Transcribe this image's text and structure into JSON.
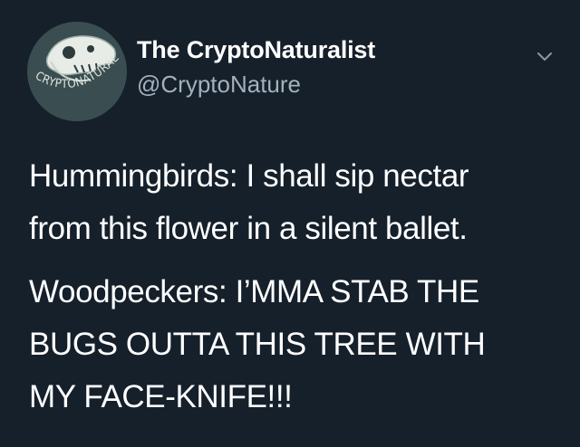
{
  "author": {
    "display_name": "The CryptoNaturalist",
    "handle": "@CryptoNature",
    "avatar_text": "CRYPTONATURALIST"
  },
  "menu": {
    "icon": "chevron-down-icon"
  },
  "tweet": {
    "paragraphs": [
      {
        "lines": [
          "Hummingbirds: I shall sip nectar",
          "from this flower in a silent ballet."
        ]
      },
      {
        "lines": [
          "Woodpeckers: I’MMA STAB THE",
          "BUGS OUTTA THIS TREE WITH",
          "MY FACE-KNIFE!!!"
        ]
      }
    ]
  },
  "colors": {
    "background": "#15202b",
    "text": "#ffffff",
    "secondary_text": "#a3b1bd"
  }
}
